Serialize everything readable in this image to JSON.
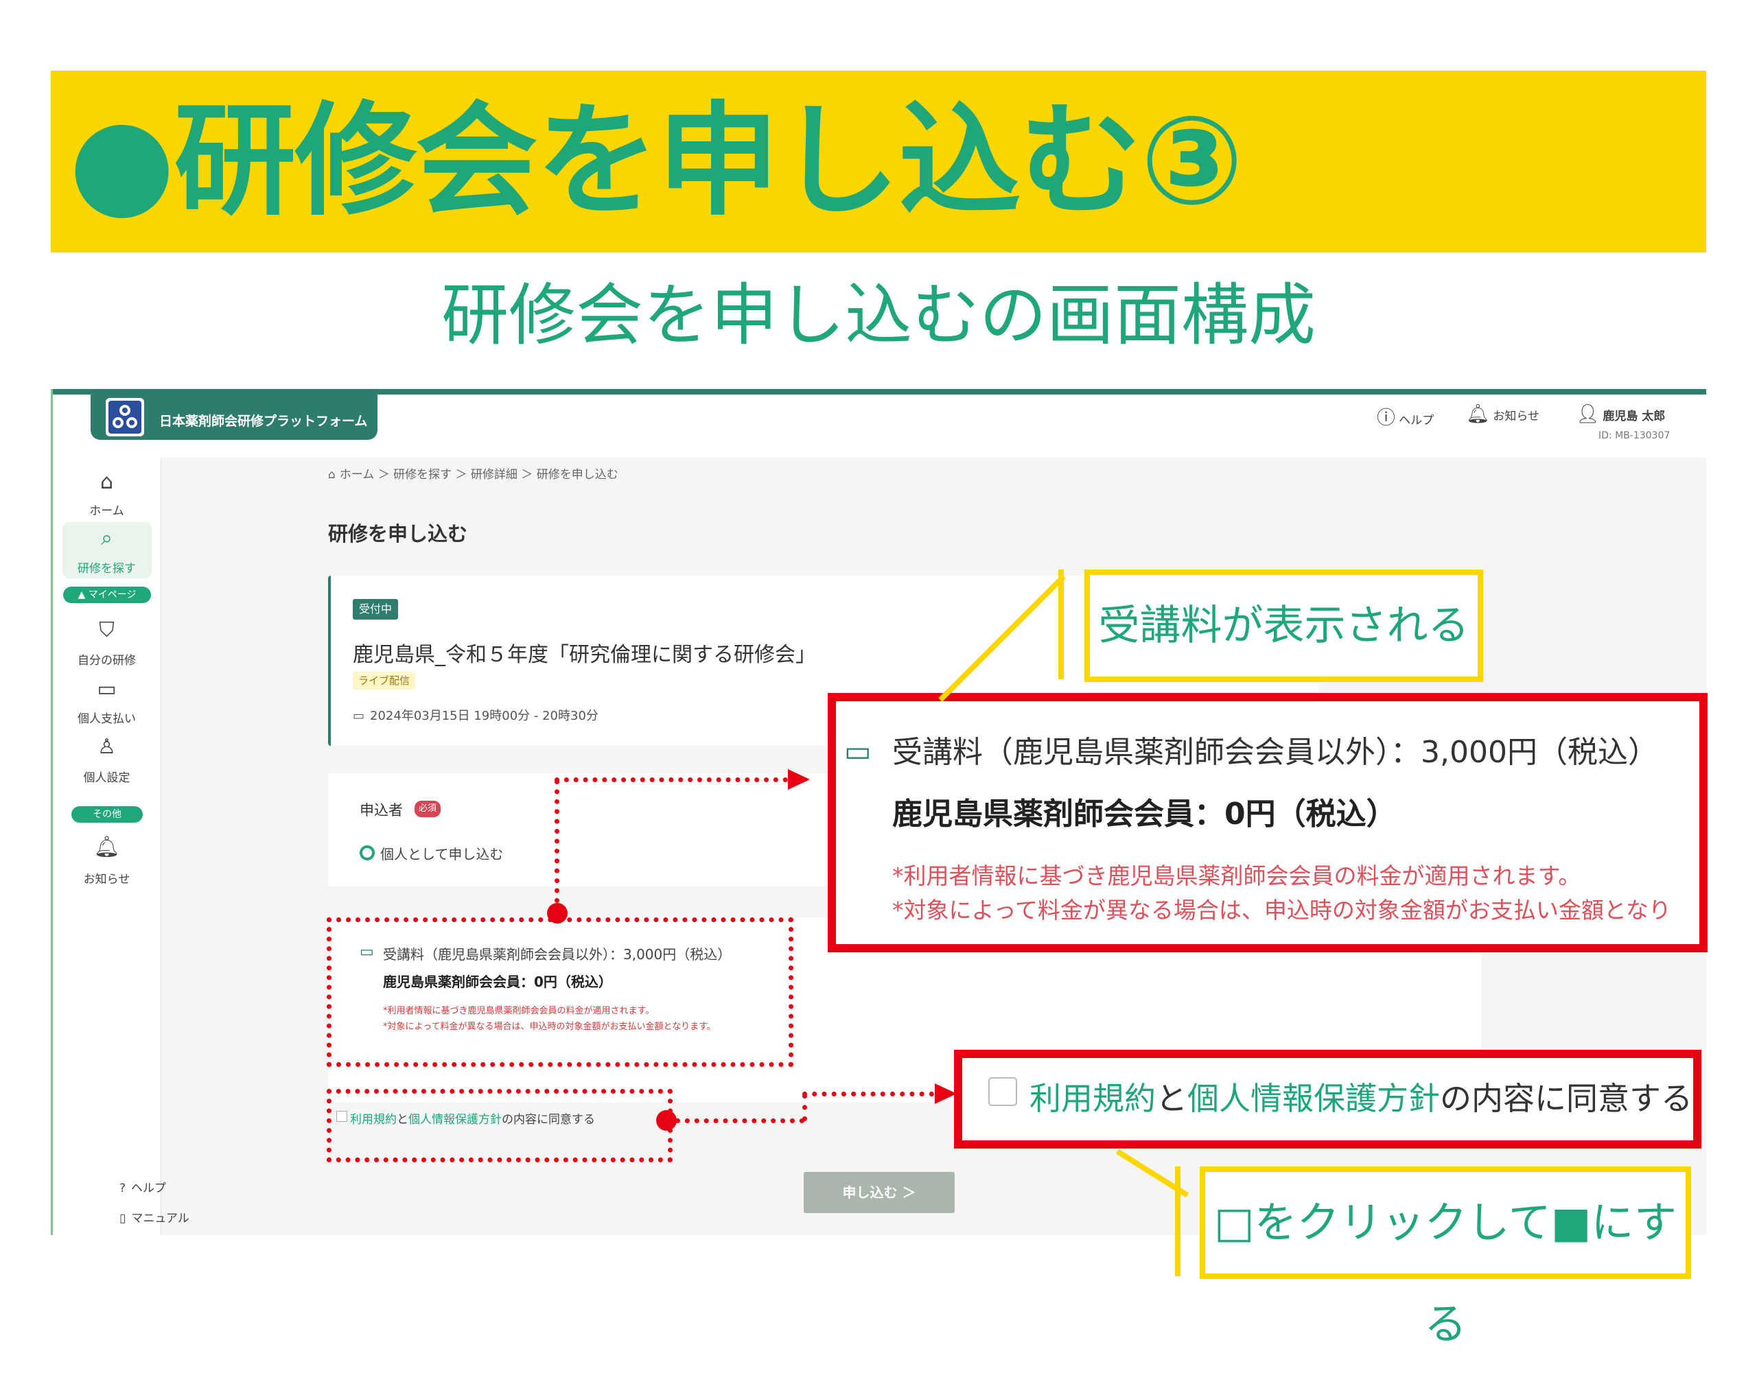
{
  "slide": {
    "title": "●研修会を申し込む③",
    "subtitle": "研修会を申し込むの画面構成"
  },
  "app": {
    "brand": "日本薬剤師会研修プラットフォーム",
    "header": {
      "help": "ヘルプ",
      "notifications": "お知らせ",
      "user_name": "鹿児島 太郎",
      "user_id": "ID: MB-130307"
    },
    "sidebar": {
      "home": "ホーム",
      "search": "研修を探す",
      "mypage_section": "▲ マイページ",
      "my_training": "自分の研修",
      "payment": "個人支払い",
      "settings": "個人設定",
      "other_section": "その他",
      "notice": "お知らせ",
      "help": "ヘルプ",
      "manual": "マニュアル"
    },
    "breadcrumb": "ホーム ＞ 研修を探す ＞ 研修詳細 ＞ 研修を申し込む",
    "page_heading": "研修を申し込む",
    "event": {
      "status": "受付中",
      "title": "鹿児島県_令和５年度「研究倫理に関する研修会」",
      "delivery": "ライブ配信",
      "datetime": "2024年03月15日 19時00分 - 20時30分"
    },
    "applicant": {
      "label": "申込者",
      "required": "必須",
      "option": "個人として申し込む"
    },
    "fee": {
      "non_member": "受講料（鹿児島県薬剤師会会員以外）：3,000円（税込）",
      "member": "鹿児島県薬剤師会会員：0円（税込）",
      "note1": "*利用者情報に基づき鹿児島県薬剤師会会員の料金が適用されます。",
      "note2": "*対象によって料金が異なる場合は、申込時の対象金額がお支払い金額となります。"
    },
    "agree": {
      "terms": "利用規約",
      "and": "と",
      "privacy": "個人情報保護方針",
      "suffix": "の内容に同意する"
    },
    "submit": "申し込む ＞"
  },
  "annotations": {
    "fee_callout": "受講料が表示される",
    "big_fee_non_member": "受講料（鹿児島県薬剤師会会員以外）：3,000円（税込）",
    "big_fee_member": "鹿児島県薬剤師会会員：0円（税込）",
    "big_note1": "*利用者情報に基づき鹿児島県薬剤師会会員の料金が適用されます。",
    "big_note2": "*対象によって料金が異なる場合は、申込時の対象金額がお支払い金額となりま",
    "check_callout": "□をクリックして■にする"
  },
  "colors": {
    "brand_green": "#1FA77A",
    "dark_green": "#2E7D6C",
    "banner_yellow": "#FDD600",
    "annotation_red": "#E60012"
  }
}
